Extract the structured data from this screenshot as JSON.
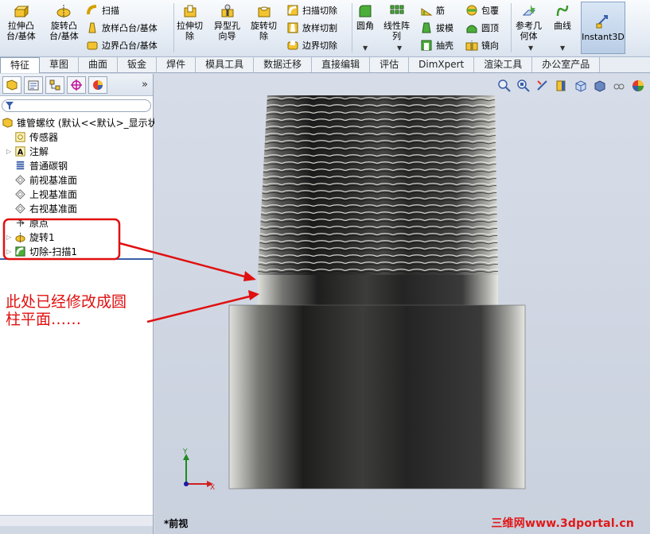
{
  "ribbon": {
    "big": [
      {
        "label1": "拉伸凸",
        "label2": "台/基体"
      },
      {
        "label1": "旋转凸",
        "label2": "台/基体"
      },
      {
        "label1": "拉伸切",
        "label2": "除"
      },
      {
        "label1": "异型孔",
        "label2": "向导"
      },
      {
        "label1": "旋转切",
        "label2": "除"
      },
      {
        "label1": "圆角",
        "label2": ""
      },
      {
        "label1": "线性阵",
        "label2": "列"
      },
      {
        "label1": "参考几",
        "label2": "何体"
      },
      {
        "label1": "曲线",
        "label2": ""
      }
    ],
    "small": {
      "sweep": "扫描",
      "loft": "放样凸台/基体",
      "boundary": "边界凸台/基体",
      "sweep_cut": "扫描切除",
      "loft_cut": "放样切割",
      "boundary_cut": "边界切除",
      "rib": "筋",
      "draft": "拔模",
      "shell": "抽壳",
      "wrap": "包覆",
      "dome": "圆顶",
      "mirror": "镜向"
    },
    "instant3d": "Instant3D"
  },
  "tabs": [
    "特征",
    "草图",
    "曲面",
    "钣金",
    "焊件",
    "模具工具",
    "数据迁移",
    "直接编辑",
    "评估",
    "DimXpert",
    "渲染工具",
    "办公室产品"
  ],
  "tree": {
    "root": "锥管螺纹 (默认<<默认>_显示状",
    "items": [
      {
        "label": "传感器",
        "icon": "sensor-icon"
      },
      {
        "label": "注解",
        "icon": "annotation-icon"
      },
      {
        "label": "普通碳钢",
        "icon": "material-icon"
      },
      {
        "label": "前视基准面",
        "icon": "plane-icon"
      },
      {
        "label": "上视基准面",
        "icon": "plane-icon"
      },
      {
        "label": "右视基准面",
        "icon": "plane-icon"
      },
      {
        "label": "原点",
        "icon": "origin-icon"
      },
      {
        "label": "旋转1",
        "icon": "revolve-icon"
      },
      {
        "label": "切除-扫描1",
        "icon": "sweep-cut-icon"
      }
    ]
  },
  "annotation": {
    "line1": "此处已经修改成圆",
    "line2": "柱平面……"
  },
  "viewport": {
    "view_name": "*前视",
    "watermark": "三维网www.3dportal.cn"
  },
  "colors": {
    "annotation_red": "#e01010",
    "highlight_blue": "#3a5fa8"
  }
}
